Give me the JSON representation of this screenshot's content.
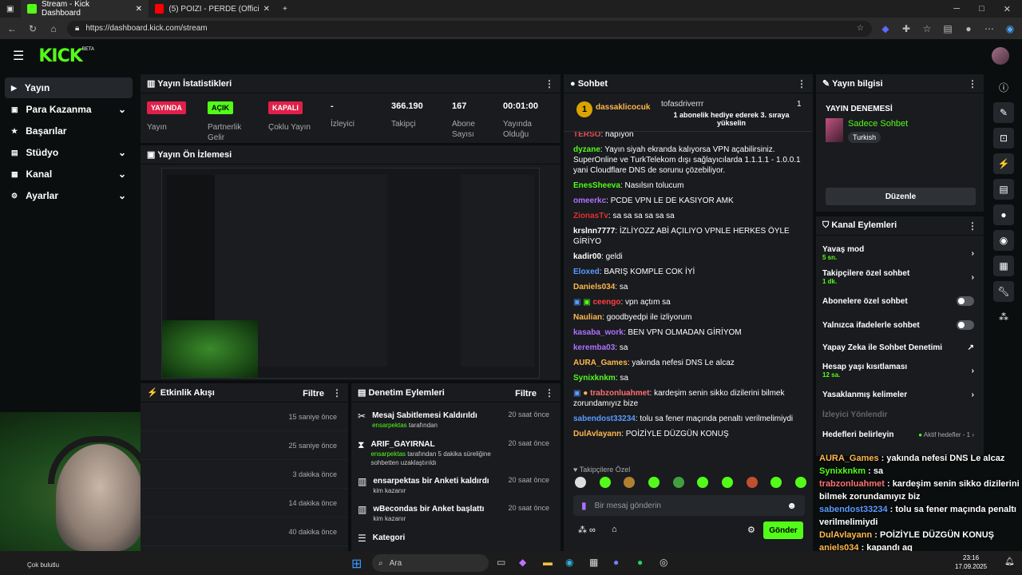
{
  "browser": {
    "tabs": [
      {
        "label": "Stream - Kick Dashboard"
      },
      {
        "label": "(5) POIZI - PERDE (Official Video)"
      }
    ],
    "url": "https://dashboard.kick.com/stream"
  },
  "kick": {
    "logo": "KICK",
    "beta": "BETA"
  },
  "sidebar": {
    "items": [
      {
        "label": "Yayın",
        "icon": "▶"
      },
      {
        "label": "Para Kazanma",
        "icon": "▣"
      },
      {
        "label": "Başarılar",
        "icon": "★"
      },
      {
        "label": "Stüdyo",
        "icon": "▤"
      },
      {
        "label": "Kanal",
        "icon": "▦"
      },
      {
        "label": "Ayarlar",
        "icon": "⚙"
      }
    ]
  },
  "stats": {
    "title": "Yayın İstatistikleri",
    "cols": [
      {
        "value": "YAYINDA",
        "label": "Yayın"
      },
      {
        "value": "AÇIK",
        "label": "Partnerlik Gelir"
      },
      {
        "value": "KAPALI",
        "label": "Çoklu Yayın"
      },
      {
        "value": "-",
        "label": "İzleyici"
      },
      {
        "value": "366.190",
        "label": "Takipçi"
      },
      {
        "value": "167",
        "label": "Abone Sayısı"
      },
      {
        "value": "00:01:00",
        "label": "Yayında Olduğu"
      }
    ]
  },
  "preview": {
    "title": "Yayın Ön İzlemesi"
  },
  "activity": {
    "title": "Etkinlik Akışı",
    "filter": "Filtre",
    "times": [
      "15 saniye önce",
      "25 saniye önce",
      "3 dakika önce",
      "14 dakika önce",
      "40 dakika önce"
    ]
  },
  "mod": {
    "title": "Denetim Eylemleri",
    "filter": "Filtre",
    "rows": [
      {
        "title": "Mesaj Sabitlemesi Kaldırıldı",
        "user": "ensarpektas",
        "rest": "tarafından",
        "time": "20 saat önce"
      },
      {
        "title": "ARIF_GAYIRNAL",
        "user": "ensarpektas",
        "rest": "tarafından 5 dakika süreliğine sohbetten uzaklaştırıldı",
        "time": "20 saat önce"
      },
      {
        "title": "ensarpektas bir Anketi kaldırdı",
        "user": "",
        "rest": "kim kazanır",
        "time": "20 saat önce"
      },
      {
        "title": "wBecondas bir Anket başlattı",
        "user": "",
        "rest": "kim kazanır",
        "time": "20 saat önce"
      },
      {
        "title": "Kategori",
        "user": "",
        "rest": "",
        "time": ""
      }
    ]
  },
  "chat": {
    "title": "Sohbet",
    "top_gifter": "dassaklicocuk",
    "gift_user": "tofasdriverrr",
    "gift_count": "1",
    "gift_text": "1 abonelik hediye ederek 3. sıraya yükselin",
    "messages": [
      {
        "user": "TERSO",
        "color": "#e05050",
        "text": "hapıyon"
      },
      {
        "user": "dyzane",
        "color": "#53fc18",
        "text": "Yayın siyah ekranda kalıyorsa VPN açabilirsiniz. SuperOnline ve TurkTelekom dışı sağlayıcılarda 1.1.1.1 - 1.0.0.1 yani Cloudflare DNS de sorunu çözebiliyor."
      },
      {
        "user": "EnesSheeva",
        "color": "#53fc18",
        "text": "Nasılsın tolucum"
      },
      {
        "user": "omeerkc",
        "color": "#b070ff",
        "text": "PCDE VPN LE DE KASIYOR AMK"
      },
      {
        "user": "ZionasTv",
        "color": "#e03030",
        "text": "sa sa sa sa sa sa"
      },
      {
        "user": "krslnn7777",
        "color": "#ffffff",
        "text": "İZLİYOZZ ABİ AÇILIYO VPNLE HERKES ÖYLE GİRİYO"
      },
      {
        "user": "kadir00",
        "color": "#ffffff",
        "text": "geldi"
      },
      {
        "user": "Eloxed",
        "color": "#5b9bff",
        "text": "BARIŞ KOMPLE COK İYİ"
      },
      {
        "user": "Daniels034",
        "color": "#ffb84d",
        "text": "sa"
      },
      {
        "user": "ceengo",
        "color": "#ff4040",
        "text": "vpn açtım sa"
      },
      {
        "user": "Naulian",
        "color": "#ffb84d",
        "text": "goodbyedpi ile izliyorum"
      },
      {
        "user": "kasaba_work",
        "color": "#b070ff",
        "text": "BEN VPN OLMADAN GİRİYOM"
      },
      {
        "user": "keremba03",
        "color": "#b070ff",
        "text": "sa"
      },
      {
        "user": "AURA_Games",
        "color": "#ffb84d",
        "text": "yakında nefesi DNS Le alcaz"
      },
      {
        "user": "Synixknkm",
        "color": "#53fc18",
        "text": "sa"
      },
      {
        "user": "trabzonluahmet",
        "color": "#ff7070",
        "text": "kardeşim senin sikko dizilerini bilmek zorundamıyız bize"
      },
      {
        "user": "sabendost33234",
        "color": "#5b9bff",
        "text": "tolu sa fener maçında penaltı verilmelimiydi"
      },
      {
        "user": "DulAvlayann",
        "color": "#ffb84d",
        "text": "POİZİYLE DÜZGÜN KONUŞ"
      }
    ],
    "followers_only": "Takipçilere Özel",
    "input_placeholder": "Bir mesaj gönderin",
    "send": "Gönder"
  },
  "info": {
    "title": "Yayın bilgisi",
    "stream_title": "YAYIN DENEMESİ",
    "category": "Sadece Sohbet",
    "tag": "Turkish",
    "edit": "Düzenle"
  },
  "actions": {
    "title": "Kanal Eylemleri",
    "rows": [
      {
        "label": "Yavaş mod",
        "sub": "5 sn.",
        "ctrl": "chevron"
      },
      {
        "label": "Takipçilere özel sohbet",
        "sub": "1 dk.",
        "ctrl": "chevron"
      },
      {
        "label": "Abonelere özel sohbet",
        "sub": "",
        "ctrl": "toggle"
      },
      {
        "label": "Yalnızca ifadelerle sohbet",
        "sub": "",
        "ctrl": "toggle"
      },
      {
        "label": "Yapay Zeka ile Sohbet Denetimi",
        "sub": "",
        "ctrl": "link"
      },
      {
        "label": "Hesap yaşı kısıtlaması",
        "sub": "12 sa.",
        "ctrl": "chevron"
      },
      {
        "label": "Yasaklanmış kelimeler",
        "sub": "",
        "ctrl": "chevron"
      },
      {
        "label": "İzleyici Yönlendir",
        "sub": "",
        "ctrl": "none"
      },
      {
        "label": "Hedefleri belirleyin",
        "sub": "",
        "ctrl": "goal"
      }
    ],
    "goal_label": "Aktif hedefler - 1"
  },
  "overlay": [
    {
      "user": "AURA_Games",
      "color": "#ffb84d",
      "text": "yakında nefesi DNS Le alcaz"
    },
    {
      "user": "Synixknkm",
      "color": "#53fc18",
      "text": "sa"
    },
    {
      "user": "trabzonluahmet",
      "color": "#ff7070",
      "text": "kardeşim senin sikko dizilerini bilmek zorundamıyız biz"
    },
    {
      "user": "sabendost33234",
      "color": "#5b9bff",
      "text": "tolu sa fener maçında penaltı verilmelimiydi"
    },
    {
      "user": "DulAvlayann",
      "color": "#ffb84d",
      "text": "POİZİYLE DÜZGÜN KONUŞ"
    },
    {
      "user": "aniels034",
      "color": "#ffb84d",
      "text": "kapandı aq"
    }
  ],
  "taskbar": {
    "weather": "Çok bulutlu",
    "search": "Ara",
    "time": "23:16",
    "date": "17.09.2025"
  }
}
